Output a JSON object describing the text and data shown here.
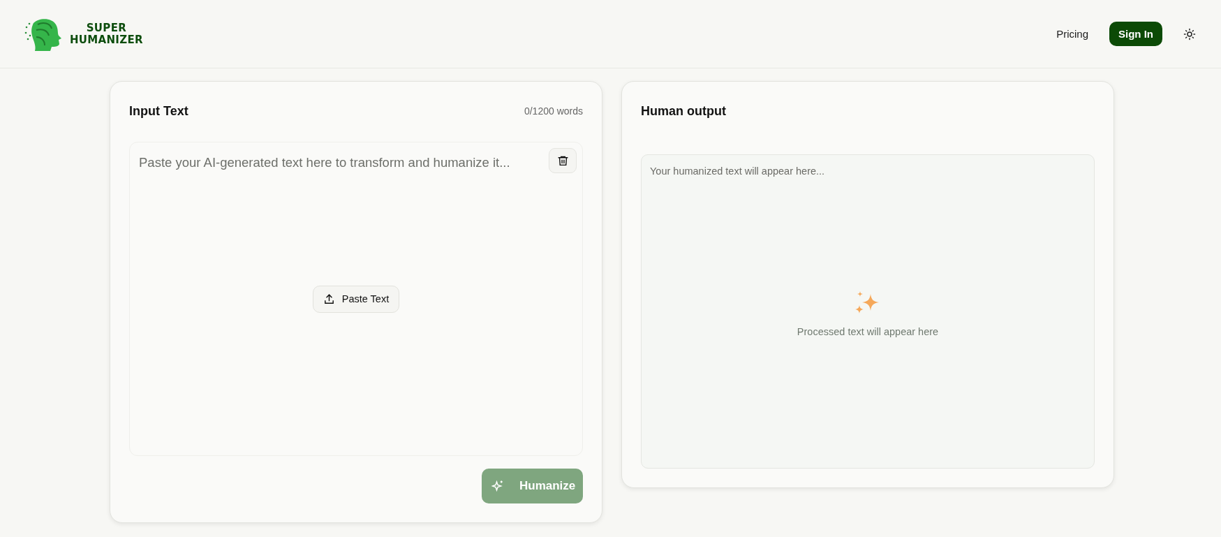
{
  "header": {
    "logo": {
      "line_1": "SUPER",
      "line_2": "HUMANIZER"
    },
    "nav": [
      {
        "label": "Pricing",
        "kind": "link"
      },
      {
        "label": "Sign In",
        "kind": "primary"
      }
    ]
  },
  "input_panel": {
    "title": "Input Text",
    "word_count": "0/1200 words",
    "placeholder": "Paste your AI-generated text here to transform and humanize it...",
    "paste_button": "Paste Text",
    "humanize_button": {
      "label": "Humanize",
      "disabled": true
    }
  },
  "output_panel": {
    "title": "Human output",
    "placeholder": "Your humanized text will appear here...",
    "empty_message": "Processed text will appear here"
  }
}
